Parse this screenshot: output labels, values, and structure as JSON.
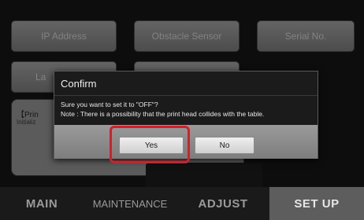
{
  "background_buttons": {
    "ip_address": "IP Address",
    "obstacle_sensor": "Obstacle Sensor",
    "serial_no": "Serial No.",
    "language_partial": "La"
  },
  "panel": {
    "title_partial": "【Prin",
    "subtitle_partial": "Initializ"
  },
  "dialog": {
    "title": "Confirm",
    "message_line1": "Sure you want to set it to \"OFF\"?",
    "message_line2": "Note : There is a possibility that the print head collides with the table.",
    "yes_label": "Yes",
    "no_label": "No"
  },
  "footer_tabs": [
    {
      "label": "MAIN",
      "active": false
    },
    {
      "label": "MAINTENANCE",
      "active": false
    },
    {
      "label": "ADJUST",
      "active": false
    },
    {
      "label": "SET UP",
      "active": true
    }
  ],
  "colors": {
    "highlight": "#d41f2a",
    "active_tab": "#5d5d5d"
  }
}
